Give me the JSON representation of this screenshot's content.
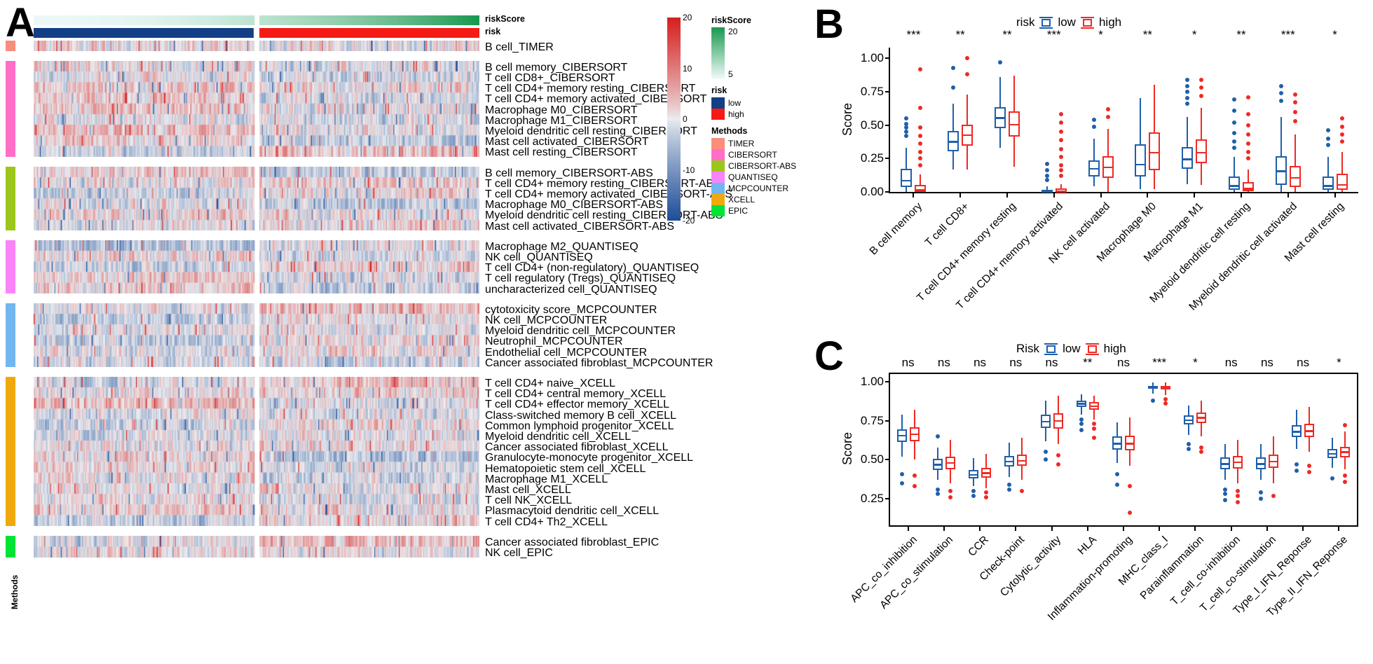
{
  "panels": {
    "a_letter": "A",
    "b_letter": "B",
    "c_letter": "C"
  },
  "heatmap": {
    "annotation_labels": {
      "riskScore": "riskScore",
      "risk": "risk"
    },
    "methods_axis_label": "Methods",
    "colors": {
      "high": "#d6201f",
      "low": "#1f4e99",
      "risk_low": "#123f86",
      "risk_high": "#f41b16",
      "riskscore_high": "#1a9850",
      "riskscore_low": "#ecf8f6"
    },
    "colorbar": {
      "ticks": [
        "20",
        "10",
        "0",
        "-10",
        "-20"
      ],
      "max": 20,
      "min": -20
    },
    "legends": [
      {
        "title": "riskScore",
        "type": "gradient",
        "top_label": "20",
        "bottom_label": "5",
        "from": "#1a9850",
        "to": "#f2fbfa"
      },
      {
        "title": "risk",
        "type": "discrete",
        "items": [
          {
            "label": "low",
            "color": "#123f86"
          },
          {
            "label": "high",
            "color": "#f41b16"
          }
        ]
      },
      {
        "title": "Methods",
        "type": "discrete",
        "items": [
          {
            "label": "TIMER",
            "color": "#fa8d7c"
          },
          {
            "label": "CIBERSORT",
            "color": "#ff6ec7"
          },
          {
            "label": "CIBERSORT-ABS",
            "color": "#9cc61b"
          },
          {
            "label": "QUANTISEQ",
            "color": "#f983f9"
          },
          {
            "label": "MCPCOUNTER",
            "color": "#72b6f0"
          },
          {
            "label": "XCELL",
            "color": "#f0a90c"
          },
          {
            "label": "EPIC",
            "color": "#00e436"
          }
        ]
      }
    ],
    "groups": [
      {
        "method": "TIMER",
        "color": "#fa8d7c",
        "rows": [
          "B cell_TIMER"
        ]
      },
      {
        "method": "CIBERSORT",
        "color": "#ff6ec7",
        "rows": [
          "B cell memory_CIBERSORT",
          "T cell CD8+_CIBERSORT",
          "T cell CD4+ memory resting_CIBERSORT",
          "T cell CD4+ memory activated_CIBERSORT",
          "Macrophage M0_CIBERSORT",
          "Macrophage M1_CIBERSORT",
          "Myeloid dendritic cell resting_CIBERSORT",
          "Mast cell activated_CIBERSORT",
          "Mast cell resting_CIBERSORT"
        ]
      },
      {
        "method": "CIBERSORT-ABS",
        "color": "#9cc61b",
        "rows": [
          "B cell memory_CIBERSORT-ABS",
          "T cell CD4+ memory resting_CIBERSORT-ABS",
          "T cell CD4+ memory activated_CIBERSORT-ABS",
          "Macrophage M0_CIBERSORT-ABS",
          "Myeloid dendritic cell resting_CIBERSORT-ABS",
          "Mast cell activated_CIBERSORT-ABS"
        ]
      },
      {
        "method": "QUANTISEQ",
        "color": "#f983f9",
        "rows": [
          "Macrophage M2_QUANTISEQ",
          "NK cell_QUANTISEQ",
          "T cell CD4+ (non-regulatory)_QUANTISEQ",
          "T cell regulatory (Tregs)_QUANTISEQ",
          "uncharacterized cell_QUANTISEQ"
        ]
      },
      {
        "method": "MCPCOUNTER",
        "color": "#72b6f0",
        "rows": [
          "cytotoxicity score_MCPCOUNTER",
          "NK cell_MCPCOUNTER",
          "Myeloid dendritic cell_MCPCOUNTER",
          "Neutrophil_MCPCOUNTER",
          "Endothelial cell_MCPCOUNTER",
          "Cancer associated fibroblast_MCPCOUNTER"
        ]
      },
      {
        "method": "XCELL",
        "color": "#f0a90c",
        "rows": [
          "T cell CD4+ naive_XCELL",
          "T cell CD4+ central memory_XCELL",
          "T cell CD4+ effector memory_XCELL",
          "Class-switched memory B cell_XCELL",
          "Common lymphoid progenitor_XCELL",
          "Myeloid dendritic cell_XCELL",
          "Cancer associated fibroblast_XCELL",
          "Granulocyte-monocyte progenitor_XCELL",
          "Hematopoietic stem cell_XCELL",
          "Macrophage M1_XCELL",
          "Mast cell_XCELL",
          "T cell NK_XCELL",
          "Plasmacytoid dendritic cell_XCELL",
          "T cell CD4+ Th2_XCELL"
        ]
      },
      {
        "method": "EPIC",
        "color": "#00e436",
        "rows": [
          "Cancer associated fibroblast_EPIC",
          "NK cell_EPIC"
        ]
      }
    ]
  },
  "chart_data": [
    {
      "id": "panelB",
      "type": "box",
      "title": "",
      "xlabel": "",
      "ylabel": "Score",
      "ylim": [
        0,
        1.08
      ],
      "yticks": [
        0.0,
        0.25,
        0.5,
        0.75,
        1.0
      ],
      "ytick_labels": [
        "0.00",
        "0.25",
        "0.50",
        "0.75",
        "1.00"
      ],
      "legend": {
        "title": "risk",
        "position": "top",
        "entries": [
          "low",
          "high"
        ]
      },
      "colors": {
        "low": "#1f5fa9",
        "high": "#ee2a24"
      },
      "categories": [
        "B cell memory",
        "T cell CD8+",
        "T cell CD4+ memory resting",
        "T cell CD4+ memory activated",
        "NK cell activated",
        "Macrophage M0",
        "Macrophage M1",
        "Myeloid dendritic cell resting",
        "Myeloid dendritic cell activated",
        "Mast cell resting"
      ],
      "significance": [
        "***",
        "**",
        "**",
        "***",
        "*",
        "**",
        "*",
        "**",
        "***",
        "*"
      ],
      "series": [
        {
          "name": "low",
          "boxes": [
            {
              "min": 0.0,
              "q1": 0.035,
              "med": 0.085,
              "q3": 0.175,
              "max": 0.33,
              "outliers": [
                0.42,
                0.45,
                0.48,
                0.51,
                0.55
              ]
            },
            {
              "min": 0.17,
              "q1": 0.305,
              "med": 0.375,
              "q3": 0.455,
              "max": 0.66,
              "outliers": [
                0.78,
                0.93
              ]
            },
            {
              "min": 0.33,
              "q1": 0.475,
              "med": 0.555,
              "q3": 0.635,
              "max": 0.86,
              "outliers": [
                0.97
              ]
            },
            {
              "min": 0.0,
              "q1": 0.0,
              "med": 0.005,
              "q3": 0.015,
              "max": 0.04,
              "outliers": [
                0.09,
                0.12,
                0.16,
                0.21
              ]
            },
            {
              "min": 0.04,
              "q1": 0.115,
              "med": 0.175,
              "q3": 0.235,
              "max": 0.4,
              "outliers": [
                0.49,
                0.54
              ]
            },
            {
              "min": 0.02,
              "q1": 0.115,
              "med": 0.205,
              "q3": 0.355,
              "max": 0.7,
              "outliers": []
            },
            {
              "min": 0.06,
              "q1": 0.175,
              "med": 0.245,
              "q3": 0.335,
              "max": 0.56,
              "outliers": [
                0.66,
                0.7,
                0.75,
                0.79,
                0.84
              ]
            },
            {
              "min": 0.0,
              "q1": 0.015,
              "med": 0.045,
              "q3": 0.115,
              "max": 0.26,
              "outliers": [
                0.33,
                0.38,
                0.44,
                0.52,
                0.61,
                0.69
              ]
            },
            {
              "min": 0.0,
              "q1": 0.055,
              "med": 0.155,
              "q3": 0.265,
              "max": 0.56,
              "outliers": [
                0.68,
                0.74,
                0.79
              ]
            },
            {
              "min": 0.0,
              "q1": 0.015,
              "med": 0.045,
              "q3": 0.115,
              "max": 0.26,
              "outliers": [
                0.35,
                0.4,
                0.46
              ]
            }
          ]
        },
        {
          "name": "high",
          "boxes": [
            {
              "min": 0.0,
              "q1": 0.0,
              "med": 0.015,
              "q3": 0.055,
              "max": 0.13,
              "outliers": [
                0.2,
                0.25,
                0.3,
                0.36,
                0.42,
                0.48,
                0.63,
                0.92
              ]
            },
            {
              "min": 0.17,
              "q1": 0.345,
              "med": 0.425,
              "q3": 0.505,
              "max": 0.73,
              "outliers": [
                0.88,
                1.0
              ]
            },
            {
              "min": 0.19,
              "q1": 0.415,
              "med": 0.505,
              "q3": 0.605,
              "max": 0.87,
              "outliers": []
            },
            {
              "min": 0.0,
              "q1": 0.0,
              "med": 0.005,
              "q3": 0.025,
              "max": 0.06,
              "outliers": [
                0.12,
                0.16,
                0.2,
                0.26,
                0.32,
                0.39,
                0.45,
                0.52,
                0.58
              ]
            },
            {
              "min": 0.0,
              "q1": 0.105,
              "med": 0.185,
              "q3": 0.265,
              "max": 0.47,
              "outliers": [
                0.56,
                0.62
              ]
            },
            {
              "min": 0.02,
              "q1": 0.165,
              "med": 0.295,
              "q3": 0.445,
              "max": 0.8,
              "outliers": []
            },
            {
              "min": 0.05,
              "q1": 0.215,
              "med": 0.295,
              "q3": 0.395,
              "max": 0.63,
              "outliers": [
                0.72,
                0.78,
                0.84
              ]
            },
            {
              "min": 0.0,
              "q1": 0.005,
              "med": 0.025,
              "q3": 0.075,
              "max": 0.17,
              "outliers": [
                0.25,
                0.3,
                0.36,
                0.43,
                0.5,
                0.58,
                0.71
              ]
            },
            {
              "min": 0.0,
              "q1": 0.035,
              "med": 0.105,
              "q3": 0.195,
              "max": 0.43,
              "outliers": [
                0.53,
                0.6,
                0.67,
                0.73
              ]
            },
            {
              "min": 0.0,
              "q1": 0.015,
              "med": 0.055,
              "q3": 0.135,
              "max": 0.3,
              "outliers": [
                0.38,
                0.43,
                0.49,
                0.55
              ]
            }
          ]
        }
      ]
    },
    {
      "id": "panelC",
      "type": "box",
      "title": "",
      "xlabel": "",
      "ylabel": "Score",
      "ylim": [
        0.08,
        1.05
      ],
      "yticks": [
        0.25,
        0.5,
        0.75,
        1.0
      ],
      "ytick_labels": [
        "0.25",
        "0.50",
        "0.75",
        "1.00"
      ],
      "legend": {
        "title": "Risk",
        "position": "top",
        "entries": [
          "low",
          "high"
        ]
      },
      "colors": {
        "low": "#1f5fa9",
        "high": "#ee2a24"
      },
      "categories": [
        "APC_co_inhibition",
        "APC_co_stimulation",
        "CCR",
        "Check-point",
        "Cytolytic_activity",
        "HLA",
        "Inflammation-promoting",
        "MHC_class_I",
        "Parainflammation",
        "T_cell_co-inhibition",
        "T_cell_co-stimulation",
        "Type_I_IFN_Reponse",
        "Type_II_IFN_Reponse"
      ],
      "significance": [
        "ns",
        "ns",
        "ns",
        "ns",
        "ns",
        "**",
        "ns",
        "***",
        "*",
        "ns",
        "ns",
        "ns",
        "*"
      ],
      "series": [
        {
          "name": "low",
          "boxes": [
            {
              "min": 0.52,
              "q1": 0.615,
              "med": 0.655,
              "q3": 0.695,
              "max": 0.79,
              "outliers": [
                0.35,
                0.41
              ]
            },
            {
              "min": 0.37,
              "q1": 0.435,
              "med": 0.47,
              "q3": 0.505,
              "max": 0.58,
              "outliers": [
                0.28,
                0.31,
                0.65
              ]
            },
            {
              "min": 0.33,
              "q1": 0.38,
              "med": 0.405,
              "q3": 0.435,
              "max": 0.51,
              "outliers": [
                0.27,
                0.3
              ]
            },
            {
              "min": 0.39,
              "q1": 0.455,
              "med": 0.49,
              "q3": 0.525,
              "max": 0.61,
              "outliers": [
                0.31,
                0.34
              ]
            },
            {
              "min": 0.62,
              "q1": 0.705,
              "med": 0.745,
              "q3": 0.79,
              "max": 0.88,
              "outliers": [
                0.5,
                0.55
              ]
            },
            {
              "min": 0.79,
              "q1": 0.84,
              "med": 0.86,
              "q3": 0.88,
              "max": 0.92,
              "outliers": [
                0.69,
                0.73,
                0.76
              ]
            },
            {
              "min": 0.48,
              "q1": 0.565,
              "med": 0.605,
              "q3": 0.65,
              "max": 0.74,
              "outliers": [
                0.34,
                0.41
              ]
            },
            {
              "min": 0.925,
              "q1": 0.955,
              "med": 0.965,
              "q3": 0.975,
              "max": 0.995,
              "outliers": [
                0.88
              ]
            },
            {
              "min": 0.66,
              "q1": 0.725,
              "med": 0.755,
              "q3": 0.785,
              "max": 0.85,
              "outliers": [
                0.57,
                0.6
              ]
            },
            {
              "min": 0.37,
              "q1": 0.44,
              "med": 0.475,
              "q3": 0.515,
              "max": 0.6,
              "outliers": [
                0.24,
                0.28,
                0.31
              ]
            },
            {
              "min": 0.37,
              "q1": 0.44,
              "med": 0.475,
              "q3": 0.515,
              "max": 0.6,
              "outliers": [
                0.25,
                0.29
              ]
            },
            {
              "min": 0.57,
              "q1": 0.645,
              "med": 0.68,
              "q3": 0.72,
              "max": 0.82,
              "outliers": [
                0.43,
                0.47
              ]
            },
            {
              "min": 0.45,
              "q1": 0.51,
              "med": 0.54,
              "q3": 0.57,
              "max": 0.64,
              "outliers": [
                0.38
              ]
            }
          ]
        },
        {
          "name": "high",
          "boxes": [
            {
              "min": 0.5,
              "q1": 0.62,
              "med": 0.665,
              "q3": 0.71,
              "max": 0.82,
              "outliers": [
                0.33,
                0.4
              ]
            },
            {
              "min": 0.35,
              "q1": 0.44,
              "med": 0.48,
              "q3": 0.52,
              "max": 0.63,
              "outliers": [
                0.26,
                0.3
              ]
            },
            {
              "min": 0.32,
              "q1": 0.385,
              "med": 0.415,
              "q3": 0.45,
              "max": 0.54,
              "outliers": [
                0.26,
                0.29
              ]
            },
            {
              "min": 0.37,
              "q1": 0.46,
              "med": 0.495,
              "q3": 0.535,
              "max": 0.64,
              "outliers": [
                0.3
              ]
            },
            {
              "min": 0.6,
              "q1": 0.7,
              "med": 0.75,
              "q3": 0.8,
              "max": 0.91,
              "outliers": [
                0.47,
                0.53
              ]
            },
            {
              "min": 0.76,
              "q1": 0.82,
              "med": 0.845,
              "q3": 0.87,
              "max": 0.91,
              "outliers": [
                0.64,
                0.7,
                0.73
              ]
            },
            {
              "min": 0.46,
              "q1": 0.56,
              "med": 0.605,
              "q3": 0.655,
              "max": 0.77,
              "outliers": [
                0.16,
                0.33
              ]
            },
            {
              "min": 0.915,
              "q1": 0.95,
              "med": 0.96,
              "q3": 0.972,
              "max": 0.995,
              "outliers": [
                0.86,
                0.89
              ]
            },
            {
              "min": 0.65,
              "q1": 0.735,
              "med": 0.77,
              "q3": 0.805,
              "max": 0.88,
              "outliers": [
                0.55,
                0.58
              ]
            },
            {
              "min": 0.35,
              "q1": 0.445,
              "med": 0.485,
              "q3": 0.525,
              "max": 0.63,
              "outliers": [
                0.23,
                0.27,
                0.3
              ]
            },
            {
              "min": 0.35,
              "q1": 0.45,
              "med": 0.49,
              "q3": 0.535,
              "max": 0.65,
              "outliers": [
                0.27
              ]
            },
            {
              "min": 0.55,
              "q1": 0.645,
              "med": 0.685,
              "q3": 0.73,
              "max": 0.84,
              "outliers": [
                0.42,
                0.46
              ]
            },
            {
              "min": 0.44,
              "q1": 0.515,
              "med": 0.55,
              "q3": 0.585,
              "max": 0.68,
              "outliers": [
                0.36,
                0.4,
                0.72
              ]
            }
          ]
        }
      ]
    }
  ]
}
